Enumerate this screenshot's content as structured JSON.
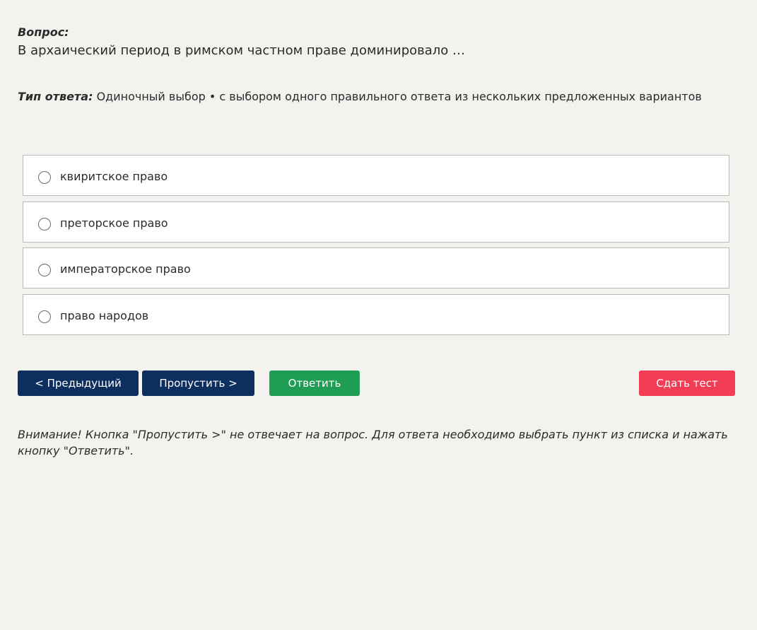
{
  "question": {
    "label": "Вопрос:",
    "text": "В архаический период в римском частном праве доминировало …"
  },
  "answer_type": {
    "label": "Тип ответа:",
    "value": "Одиночный выбор • с выбором одного правильного ответа из нескольких предложенных вариантов"
  },
  "options": [
    {
      "label": "квиритское право"
    },
    {
      "label": "преторское право"
    },
    {
      "label": "императорское право"
    },
    {
      "label": "право народов"
    }
  ],
  "buttons": {
    "prev": "< Предыдущий",
    "skip": "Пропустить >",
    "answer": "Ответить",
    "finish": "Сдать тест"
  },
  "colors": {
    "background": "#f3f2ef",
    "nav_button": "#0c2f5f",
    "answer_button": "#1f9d55",
    "finish_button": "#f23d55"
  },
  "note": "Внимание! Кнопка \"Пропустить >\" не отвечает на вопрос. Для ответа необходимо выбрать пункт из списка и нажать кнопку \"Ответить\"."
}
